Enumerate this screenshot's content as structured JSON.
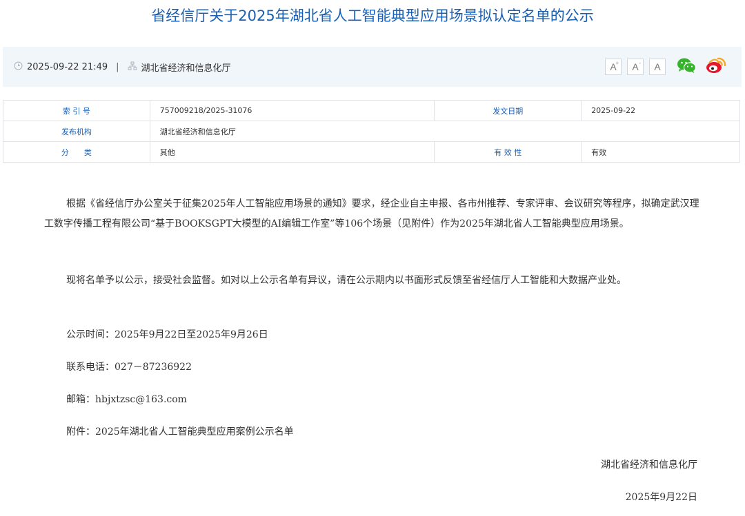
{
  "title": "省经信厅关于2025年湖北省人工智能典型应用场景拟认定名单的公示",
  "meta": {
    "datetime": "2025-09-22 21:49",
    "separator": "|",
    "publisher": "湖北省经济和信息化厅",
    "font_buttons": [
      "A",
      "A",
      "A"
    ],
    "icons": [
      "clock-icon",
      "org-icon",
      "wechat-icon",
      "weibo-icon"
    ]
  },
  "info_table": {
    "index_label": "索 引 号",
    "index_value": "757009218/2025-31076",
    "date_label": "发文日期",
    "date_value": "2025-09-22",
    "org_label": "发布机构",
    "org_value": "湖北省经济和信息化厅",
    "category_label": "分　　类",
    "category_value": "其他",
    "validity_label": "有 效 性",
    "validity_value": "有效"
  },
  "content": {
    "para1": "根据《省经信厅办公室关于征集2025年人工智能应用场景的通知》要求，经企业自主申报、各市州推荐、专家评审、会议研究等程序，拟确定武汉理工数字传播工程有限公司“基于BOOKSGPT大模型的AI编辑工作室”等106个场景（见附件）作为2025年湖北省人工智能典型应用场景。",
    "para2": "现将名单予以公示，接受社会监督。如对以上公示名单有异议，请在公示期内以书面形式反馈至省经信厅人工智能和大数据产业处。",
    "period": "公示时间：2025年9月22日至2025年9月26日",
    "phone": "联系电话：027－87236922",
    "email": "邮箱：hbjxtzsc@163.com",
    "attachment": "附件：2025年湖北省人工智能典型应用案例公示名单",
    "signature": "湖北省经济和信息化厅",
    "sign_date": "2025年9月22日"
  },
  "colors": {
    "accent": "#1a5fb4",
    "wechat": "#36b32d",
    "weibo": "#f5a623"
  }
}
